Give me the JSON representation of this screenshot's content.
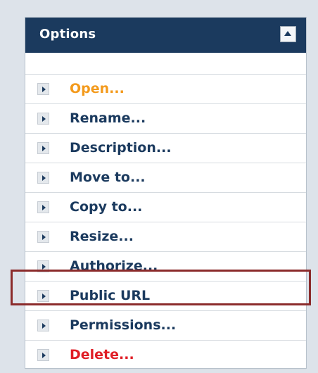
{
  "panel": {
    "title": "Options",
    "collapse_icon": "triangle-up-icon"
  },
  "menu": {
    "bullet_icon": "triangle-right-icon",
    "items": [
      {
        "label": "Open...",
        "color": "#f39a1c"
      },
      {
        "label": "Rename...",
        "color": "#1b3a5e"
      },
      {
        "label": "Description...",
        "color": "#1b3a5e"
      },
      {
        "label": "Move to...",
        "color": "#1b3a5e"
      },
      {
        "label": "Copy to...",
        "color": "#1b3a5e"
      },
      {
        "label": "Resize...",
        "color": "#1b3a5e"
      },
      {
        "label": "Authorize...",
        "color": "#1b3a5e"
      },
      {
        "label": "Public URL",
        "color": "#1b3a5e",
        "highlighted": true
      },
      {
        "label": "Permissions...",
        "color": "#1b3a5e"
      },
      {
        "label": "Delete...",
        "color": "#e01d25"
      }
    ]
  },
  "colors": {
    "header_bg": "#1b3a5e",
    "highlight_border": "#8b2b2b",
    "page_bg": "#dde3ea"
  }
}
